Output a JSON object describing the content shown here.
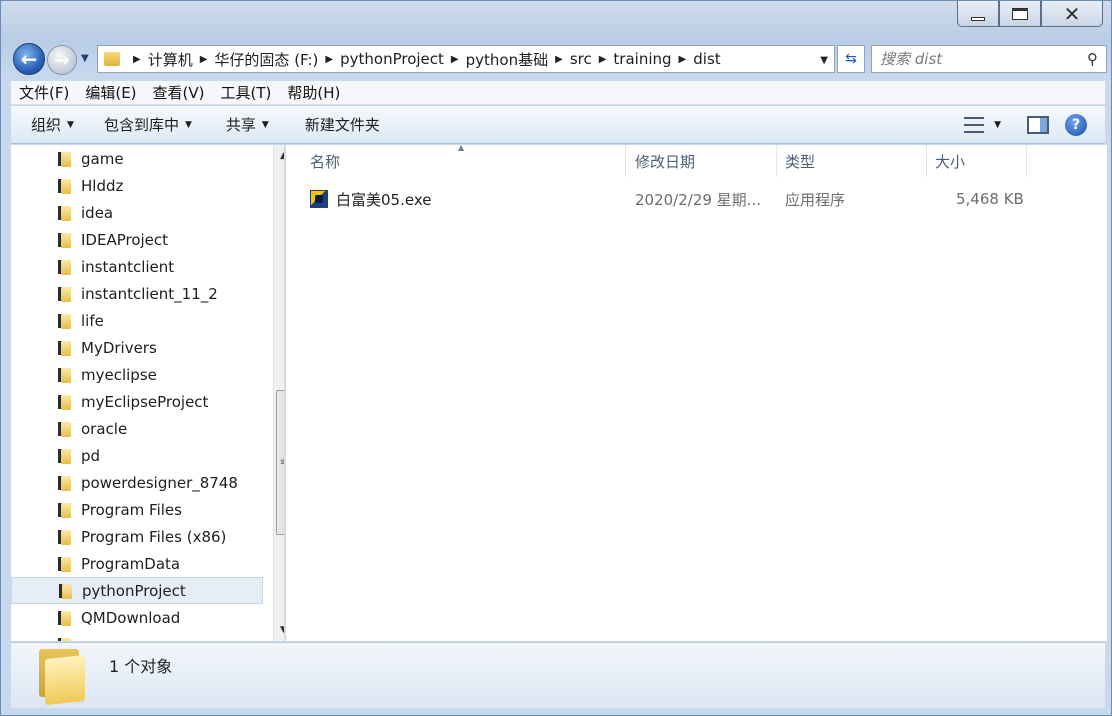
{
  "address": {
    "crumbs": [
      "计算机",
      "华仔的固态 (F:)",
      "pythonProject",
      "python基础",
      "src",
      "training",
      "dist"
    ]
  },
  "search": {
    "placeholder": "搜索 dist"
  },
  "menubar": [
    "文件(F)",
    "编辑(E)",
    "查看(V)",
    "工具(T)",
    "帮助(H)"
  ],
  "commandbar": {
    "organize": "组织",
    "include_library": "包含到库中",
    "share": "共享",
    "new_folder": "新建文件夹"
  },
  "navpane": {
    "items": [
      "game",
      "Hlddz",
      "idea",
      "IDEAProject",
      "instantclient",
      "instantclient_11_2",
      "life",
      "MyDrivers",
      "myeclipse",
      "myEclipseProject",
      "oracle",
      "pd",
      "powerdesigner_8748",
      "Program Files",
      "Program Files (x86)",
      "ProgramData",
      "pythonProject",
      "QMDownload"
    ],
    "selected": "pythonProject"
  },
  "columns": {
    "name": "名称",
    "modified": "修改日期",
    "type": "类型",
    "size": "大小"
  },
  "files": [
    {
      "name": "白富美05.exe",
      "modified": "2020/2/29 星期...",
      "type": "应用程序",
      "size": "5,468 KB",
      "icon": "exe-app-icon"
    }
  ],
  "details": {
    "status": "1 个对象"
  },
  "icons": {
    "back": "back-arrow-icon",
    "forward": "forward-arrow-icon",
    "search": "search-icon",
    "help": "help-icon",
    "folder": "folder-icon"
  }
}
